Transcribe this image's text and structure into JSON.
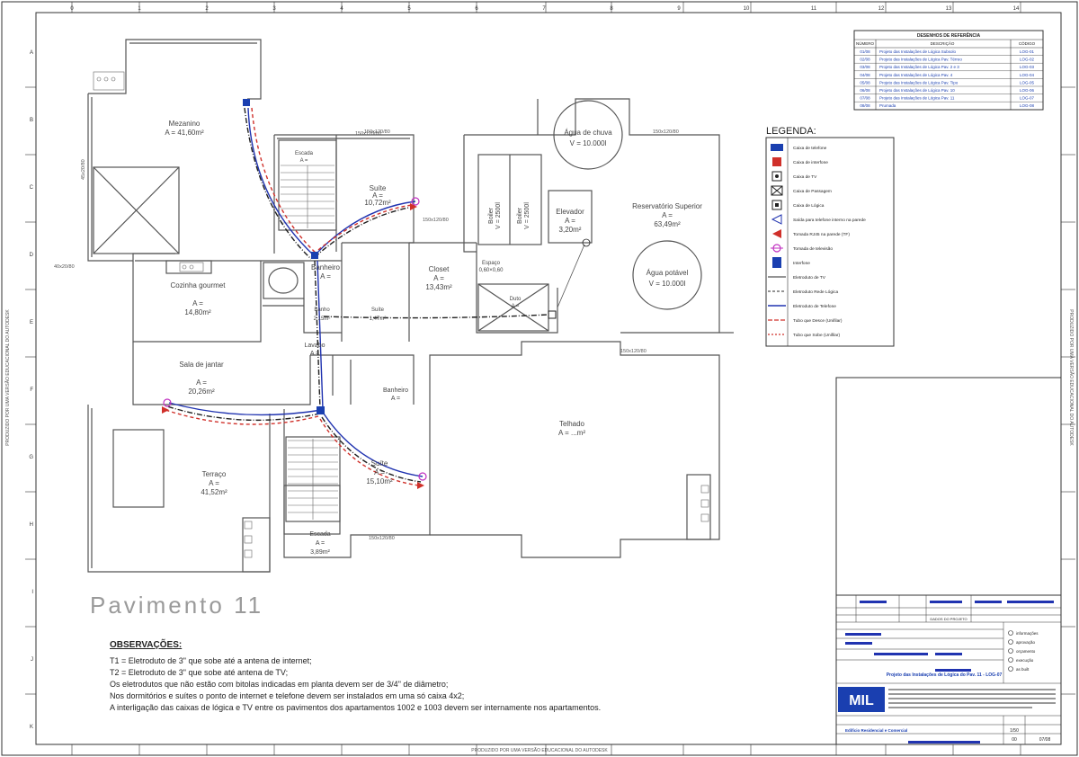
{
  "sheet": {
    "title": "Pavimento  11",
    "columns": [
      "0",
      "1",
      "2",
      "3",
      "4",
      "5",
      "6",
      "7",
      "8",
      "9",
      "10",
      "11",
      "12",
      "13",
      "14"
    ],
    "rows": [
      "A",
      "B",
      "C",
      "D",
      "E",
      "F",
      "G",
      "H",
      "I",
      "J",
      "K"
    ]
  },
  "rooms": {
    "mezanino": {
      "name": "Mezanino",
      "area": "A = 41,60m²"
    },
    "escada_top": {
      "name": "Escada",
      "area": "A ="
    },
    "suite1": {
      "name": "Suíte",
      "area": "A =",
      "value": "10,72m²"
    },
    "agua_chuva": {
      "name": "Água de chuva",
      "volume": "V = 10.000l"
    },
    "reservatorio": {
      "name": "Reservatório Superior",
      "area": "A =",
      "value": "63,49m²"
    },
    "agua_potavel": {
      "name": "Água potável",
      "volume": "V = 10.000l"
    },
    "boiler1": {
      "name": "Boiler",
      "volume": "V = 2500l"
    },
    "boiler2": {
      "name": "Boiler",
      "volume": "V = 2500l"
    },
    "elevador": {
      "name": "Elevador",
      "area": "A =",
      "value": "3,20m²"
    },
    "cozinha": {
      "name": "Cozinha gourmet",
      "area": "A =",
      "value": "14,80m²"
    },
    "banheiro1": {
      "name": "Banheiro",
      "area": "A ="
    },
    "closet": {
      "name": "Closet",
      "area": "A =",
      "value": "13,43m²"
    },
    "espaco": {
      "name": "Espaço",
      "value": "0,60×0,60"
    },
    "duto": {
      "name": "Duto",
      "area": "A ="
    },
    "banho": {
      "name": "Banho",
      "value": "2,15m²"
    },
    "suite_small": {
      "name": "Suíte",
      "value": "1,47m²"
    },
    "lavabo": {
      "name": "Lavabo",
      "area": "A ="
    },
    "sala": {
      "name": "Sala de jantar",
      "area": "A =",
      "value": "20,26m²"
    },
    "banheiro2": {
      "name": "Banheiro",
      "area": "A ="
    },
    "telhado": {
      "name": "Telhado",
      "area": "A = ...m²"
    },
    "terraco": {
      "name": "Terraço",
      "area": "A =",
      "value": "41,52m²"
    },
    "suite2": {
      "name": "Suíte",
      "area": "A =",
      "value": "15,10m²"
    },
    "escada_bottom": {
      "name": "Escada",
      "area": "A =",
      "value": "3,89m²"
    }
  },
  "dims": [
    "40x20/80",
    "150x120/80",
    "150x120/80",
    "150x120/80",
    "45x20/80",
    "150x120/80",
    "150x120/80",
    "150x120/80"
  ],
  "observacoes": {
    "title": "OBSERVAÇÕES:",
    "lines": [
      "T1 = Eletroduto de 3\" que sobe até a antena de internet;",
      "T2 = Eletroduto de 3\" que sobe até antena de TV;",
      "Os eletrodutos que não estão com bitolas indicadas em planta devem ser de 3/4\" de diâmetro;",
      "Nos dormitórios e suítes o ponto de internet e telefone devem ser instalados em uma só caixa 4x2;",
      "A interligação das caixas de lógica e TV entre os pavimentos dos apartamentos 1002 e 1003 devem ser internamente nos apartamentos."
    ]
  },
  "legenda": {
    "title": "LEGENDA:",
    "items": [
      {
        "label": "Caixa de telefone",
        "symbol": "blue-box-icon"
      },
      {
        "label": "Caixa de interfone",
        "symbol": "red-box-icon"
      },
      {
        "label": "Caixa de TV",
        "symbol": "tv-box-icon"
      },
      {
        "label": "Caixa de Passagem",
        "symbol": "pass-box-icon"
      },
      {
        "label": "Caixa de Lógica",
        "symbol": "logic-box-icon"
      },
      {
        "label": "Saída para telefone interno na parede",
        "symbol": "phone-outlet-icon"
      },
      {
        "label": "Tomada RJ45 na parede (TF)",
        "symbol": "rj45-outlet-icon"
      },
      {
        "label": "Tomada de televisão",
        "symbol": "tv-outlet-icon"
      },
      {
        "label": "Interfone",
        "symbol": "intercom-icon"
      },
      {
        "label": "Eletroduto de TV",
        "symbol": "tv-conduit-line"
      },
      {
        "label": "Eletroduto Rede Lógica",
        "symbol": "logic-conduit-line"
      },
      {
        "label": "Eletroduto de Telefone",
        "symbol": "phone-conduit-line"
      },
      {
        "label": "Tubo que Desce (Unifilar)",
        "symbol": "pipe-down-line"
      },
      {
        "label": "Tubo que Sobe (Unifilar)",
        "symbol": "pipe-up-line"
      }
    ]
  },
  "desenhos_referencia": {
    "title": "DESENHOS DE REFERÊNCIA",
    "headers": [
      "NÚMERO",
      "DESCRIÇÃO",
      "CÓDIGO"
    ],
    "rows": [
      [
        "01/08",
        "Projeto das Instalações de Lógica Subsolo",
        "LOG-01"
      ],
      [
        "02/08",
        "Projeto das Instalações de Lógica Pav. Térreo",
        "LOG-02"
      ],
      [
        "03/08",
        "Projeto das Instalações de Lógica Pav. 2 e 3",
        "LOG-03"
      ],
      [
        "04/08",
        "Projeto das Instalações de Lógica Pav. 4",
        "LOG-04"
      ],
      [
        "05/08",
        "Projeto das Instalações de Lógica Pav. Tipo",
        "LOG-05"
      ],
      [
        "06/08",
        "Projeto das Instalações de Lógica Pav. 10",
        "LOG-06"
      ],
      [
        "07/08",
        "Projeto das Instalações de Lógica Pav. 11",
        "LOG-07"
      ],
      [
        "08/08",
        "Prumada",
        "LOG-08"
      ]
    ]
  },
  "carimbo": {
    "project_title": "Projeto das Instalações de Lógica do Pav. 11 - LOG-07",
    "company": "MIL",
    "obra": "Edifício Residencial e Comercial",
    "sheet_number": "07/08",
    "scale": "1/50",
    "checklist": [
      "informações",
      "aprovação",
      "orçamento",
      "execução",
      "as built"
    ],
    "revision": "00",
    "table_header": "DADOS DO PROJETO"
  },
  "colors": {
    "line": "#555555",
    "tv": "#d0302a",
    "logic": "#202020",
    "phone": "#2033b0",
    "blue_fill": "#1a3fb0",
    "magenta": "#c030c0"
  }
}
